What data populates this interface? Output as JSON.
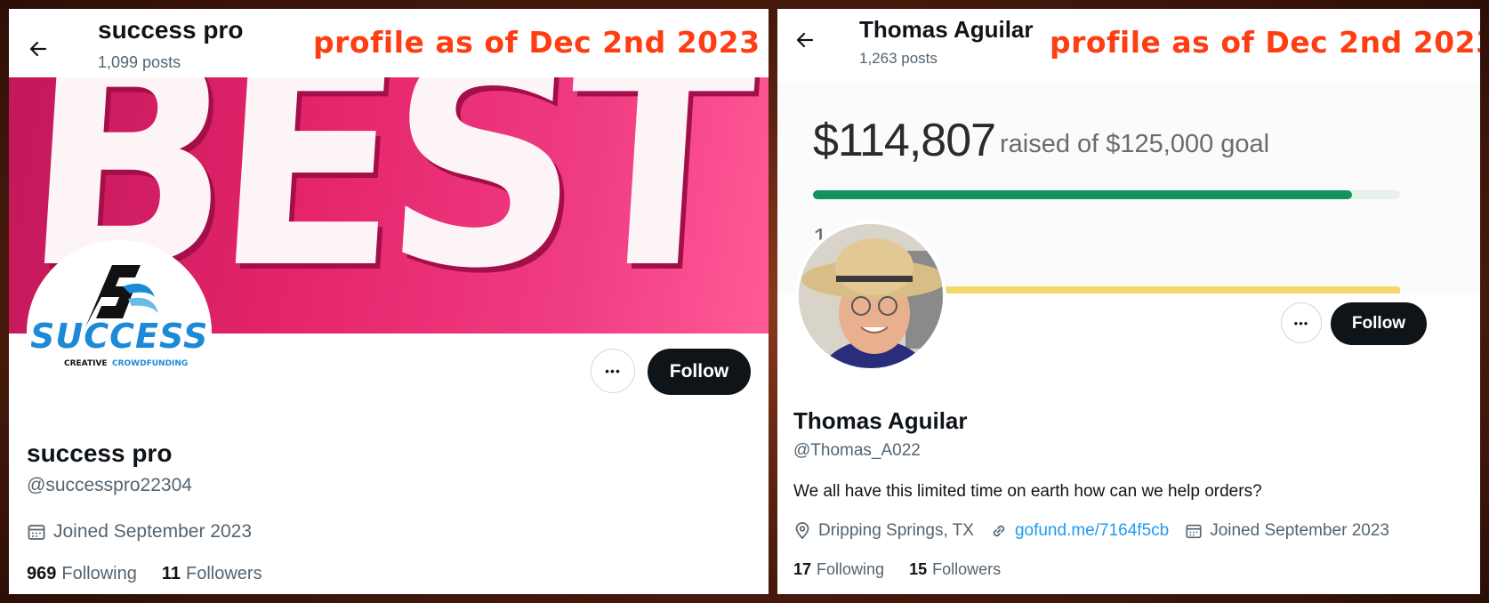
{
  "annotation": {
    "text": "profile as of Dec 2nd 2023",
    "color": "#ff3d12"
  },
  "left_profile": {
    "header": {
      "name": "success pro",
      "post_count": "1,099 posts"
    },
    "banner": {
      "text": "BEST",
      "color": "#e5246b"
    },
    "avatar": {
      "logo_letter": "S",
      "logo_word": "SUCCESS",
      "tag_left": "CREATIVE",
      "tag_right": "CROWDFUNDING"
    },
    "buttons": {
      "follow": "Follow",
      "more": "•••"
    },
    "name": "success pro",
    "handle": "@successpro22304",
    "joined": "Joined September 2023",
    "stats": {
      "following_count": "969",
      "following_label": "Following",
      "followers_count": "11",
      "followers_label": "Followers"
    }
  },
  "right_profile": {
    "header": {
      "name": "Thomas Aguilar",
      "post_count": "1,263 posts"
    },
    "banner": {
      "amount": "$114,807",
      "goal_text": "raised of $125,000 goal",
      "progress": 0.918,
      "donations_text": "1   tions",
      "progress_color": "#14925a"
    },
    "buttons": {
      "follow": "Follow",
      "more": "•••"
    },
    "name": "Thomas Aguilar",
    "handle": "@Thomas_A022",
    "bio": "We all have this limited time on earth how can we help orders?",
    "location": "Dripping Springs, TX",
    "website": "gofund.me/7164f5cb",
    "joined": "Joined September 2023",
    "stats": {
      "following_count": "17",
      "following_label": "Following",
      "followers_count": "15",
      "followers_label": "Followers"
    }
  }
}
